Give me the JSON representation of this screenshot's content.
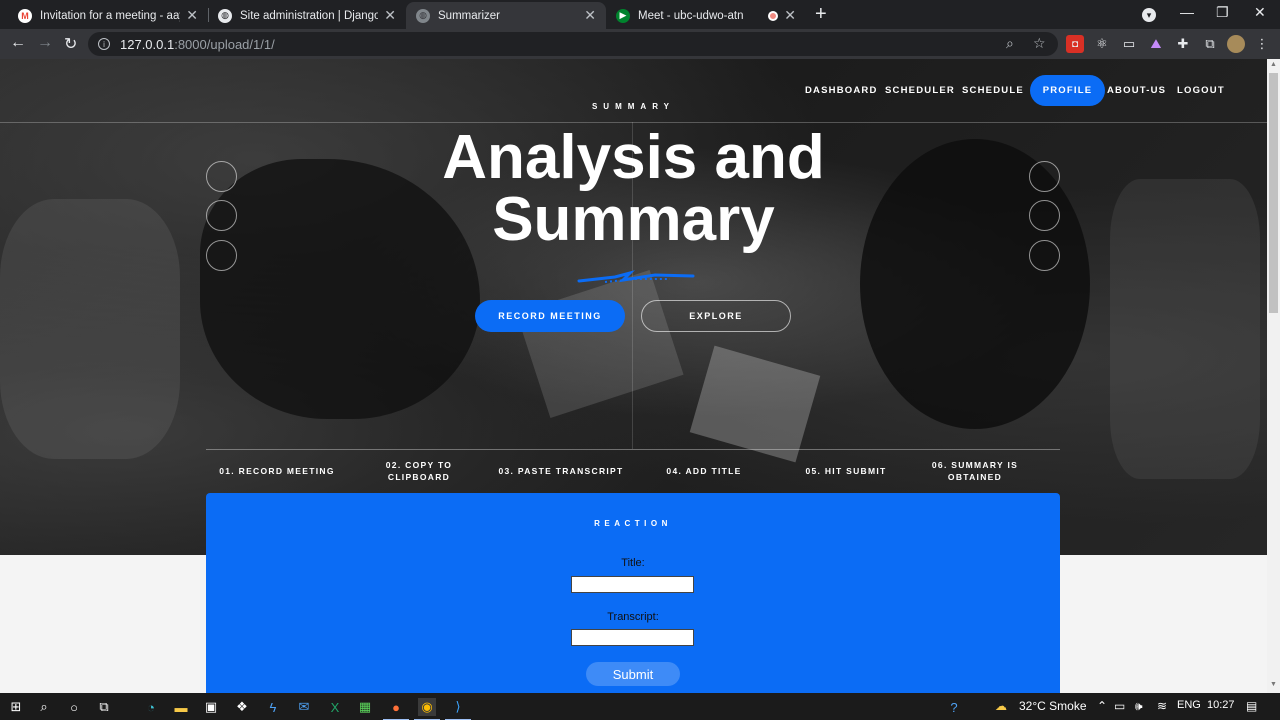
{
  "browser": {
    "tabs": [
      {
        "label": "Invitation for a meeting - aayush",
        "icon": "gmail-icon",
        "active": false
      },
      {
        "label": "Site administration | Django site",
        "icon": "globe-icon",
        "active": false
      },
      {
        "label": "Summarizer",
        "icon": "globe-icon",
        "active": true
      },
      {
        "label": "Meet - ubc-udwo-atn",
        "icon": "meet-icon",
        "active": false
      }
    ],
    "url_host": "127.0.0.1",
    "url_path": ":8000/upload/1/1/",
    "colors": {
      "frame": "#202124",
      "toolbar": "#35363a"
    }
  },
  "site": {
    "nav": {
      "items": [
        "DASHBOARD",
        "SCHEDULER",
        "SCHEDULE",
        "PROFILE",
        "ABOUT-US",
        "LOGOUT"
      ],
      "active": "PROFILE"
    },
    "eyebrow": "SUMMARY",
    "headline_line1": "Analysis and",
    "headline_line2": "Summary",
    "buttons": {
      "primary": "RECORD MEETING",
      "secondary": "EXPLORE"
    },
    "steps": [
      "01. RECORD MEETING",
      "02. COPY TO CLIPBOARD",
      "03. PASTE TRANSCRIPT",
      "04. ADD TITLE",
      "05. HIT SUBMIT",
      "06. SUMMARY IS OBTAINED"
    ],
    "form": {
      "heading": "REACTION",
      "title_label": "Title:",
      "title_value": "",
      "transcript_label": "Transcript:",
      "transcript_value": "",
      "submit_label": "Submit"
    },
    "colors": {
      "accent": "#0b6cf5"
    }
  },
  "taskbar": {
    "weather": "32°C  Smoke",
    "language": "ENG",
    "time": "10:27"
  }
}
